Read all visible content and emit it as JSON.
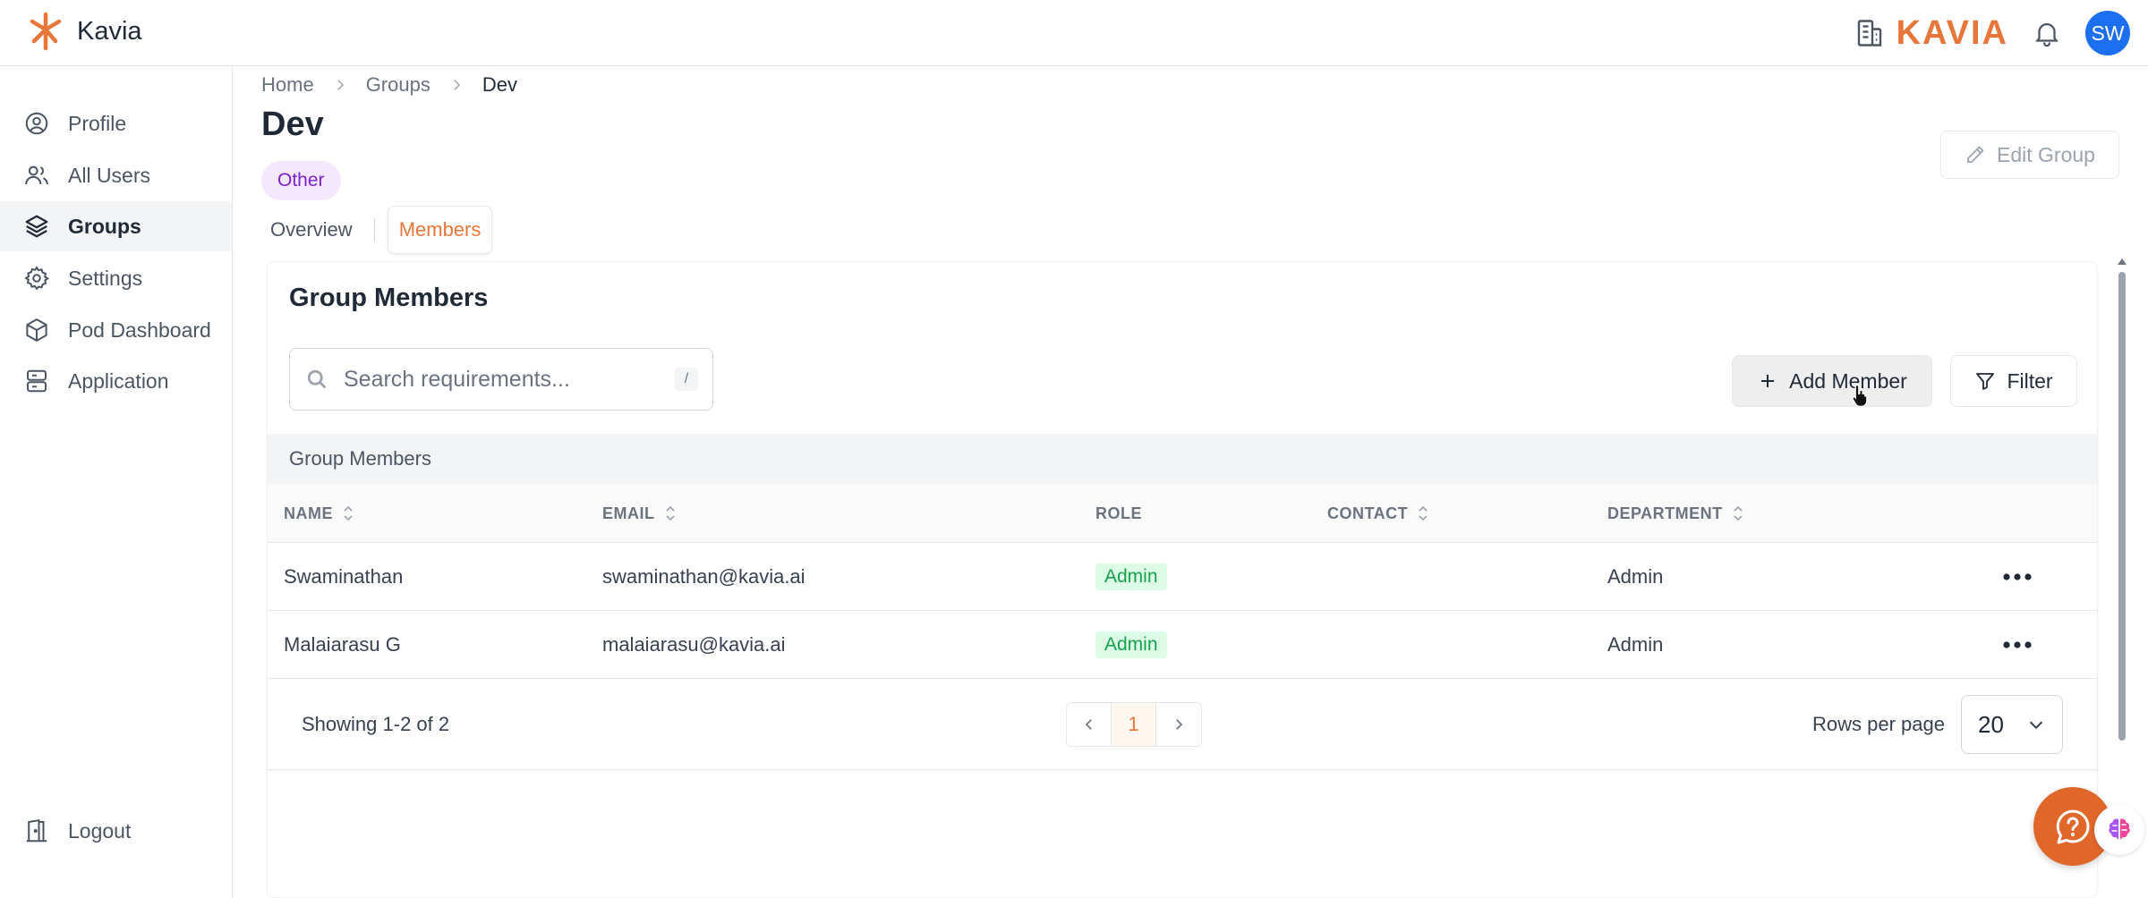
{
  "app": {
    "name": "Kavia",
    "brand_word": "KAVIA",
    "avatar_initials": "SW",
    "accent_color": "#e8763a"
  },
  "sidebar": {
    "items": [
      {
        "label": "Profile",
        "icon": "user-circle-icon"
      },
      {
        "label": "All Users",
        "icon": "users-icon"
      },
      {
        "label": "Groups",
        "icon": "layers-icon",
        "active": true
      },
      {
        "label": "Settings",
        "icon": "gear-icon"
      },
      {
        "label": "Pod Dashboard",
        "icon": "box-icon"
      },
      {
        "label": "Application",
        "icon": "server-icon"
      }
    ],
    "logout_label": "Logout"
  },
  "breadcrumb": [
    "Home",
    "Groups",
    "Dev"
  ],
  "page": {
    "title": "Dev",
    "chip": "Other",
    "edit_label": "Edit Group"
  },
  "tabs": [
    {
      "label": "Overview"
    },
    {
      "label": "Members",
      "active": true
    }
  ],
  "members_panel": {
    "title": "Group Members",
    "search_placeholder": "Search requirements...",
    "search_shortcut": "/",
    "add_label": "Add Member",
    "filter_label": "Filter",
    "table_caption": "Group Members",
    "columns": [
      "NAME",
      "EMAIL",
      "ROLE",
      "CONTACT",
      "DEPARTMENT"
    ],
    "rows": [
      {
        "name": "Swaminathan",
        "email": "swaminathan@kavia.ai",
        "role": "Admin",
        "contact": "",
        "department": "Admin"
      },
      {
        "name": "Malaiarasu G",
        "email": "malaiarasu@kavia.ai",
        "role": "Admin",
        "contact": "",
        "department": "Admin"
      }
    ],
    "showing": "Showing 1-2 of 2",
    "current_page": "1",
    "rows_per_page_label": "Rows per page",
    "rows_per_page": "20"
  }
}
